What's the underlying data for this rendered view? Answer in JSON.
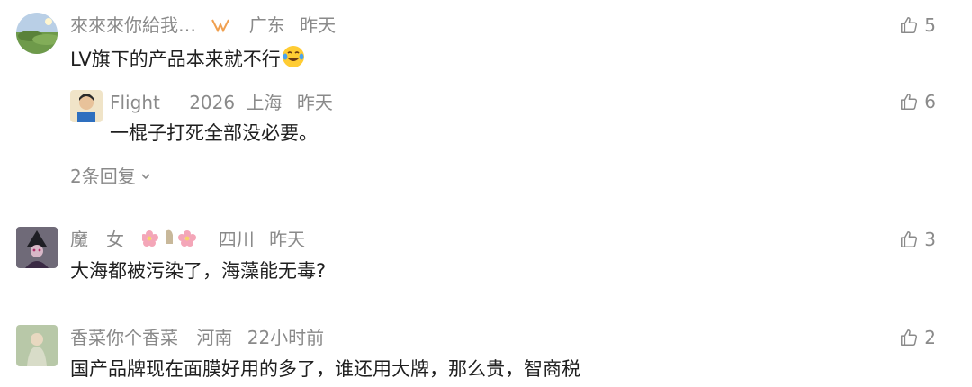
{
  "comments": [
    {
      "user": "來來來你給我…",
      "badge_icon": "tag-icon",
      "region": "广东",
      "time": "昨天",
      "text": "LV旗下的产品本来就不行",
      "emoji": "laugh-cry-emoji",
      "likes": "5",
      "reply": {
        "user": "Flight",
        "badge": "2026",
        "region": "上海",
        "time": "昨天",
        "text": "一棍子打死全部没必要。",
        "likes": "6"
      },
      "reply_count_label": "2条回复"
    },
    {
      "user": "魔　女",
      "badge_icon": "flower-emoji-badge",
      "region": "四川",
      "time": "昨天",
      "text": "大海都被污染了，海藻能无毒?",
      "likes": "3"
    },
    {
      "user": "香菜你个香菜",
      "region": "河南",
      "time": "22小时前",
      "text": "国产品牌现在面膜好用的多了，谁还用大牌，那么贵，智商税",
      "likes": "2"
    }
  ],
  "colors": {
    "meta": "#8a8a8a",
    "text": "#1f1f1f",
    "accent": "#f0a050"
  }
}
